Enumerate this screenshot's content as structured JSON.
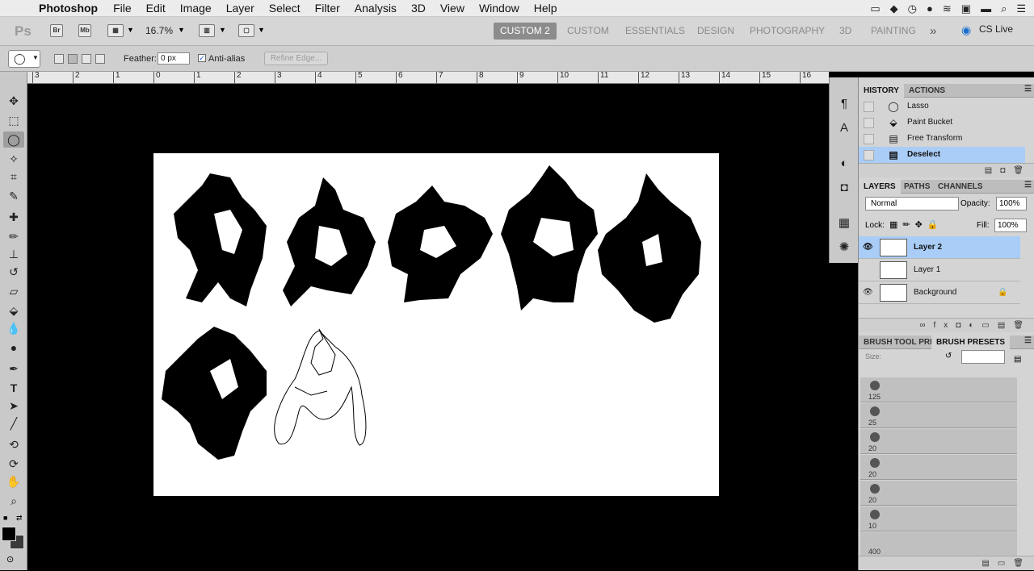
{
  "menubar": {
    "apple_icon": "apple-icon",
    "app_name": "Photoshop",
    "items": [
      "File",
      "Edit",
      "Image",
      "Layer",
      "Select",
      "Filter",
      "Analysis",
      "3D",
      "View",
      "Window",
      "Help"
    ]
  },
  "appbar": {
    "logo": "Ps",
    "bridge": "Br",
    "minibridge": "Mb",
    "zoom": "16.7%",
    "workspaces": [
      "CUSTOM 2",
      "CUSTOM",
      "ESSENTIALS",
      "DESIGN",
      "PHOTOGRAPHY",
      "3D",
      "PAINTING"
    ],
    "active_workspace": "CUSTOM 2",
    "more": "»",
    "cs_live": "CS Live"
  },
  "options": {
    "feather_label": "Feather:",
    "feather_value": "0 px",
    "antialias_label": "Anti-alias",
    "antialias_checked": true,
    "refine_edge": "Refine Edge..."
  },
  "ruler": {
    "labels": [
      "3",
      "2",
      "1",
      "0",
      "1",
      "2",
      "3",
      "4",
      "5",
      "6",
      "7",
      "8",
      "9",
      "10",
      "11",
      "12",
      "13",
      "14",
      "15",
      "16"
    ]
  },
  "history": {
    "tabs": [
      "HISTORY",
      "ACTIONS"
    ],
    "items": [
      {
        "name": "Lasso",
        "icon": "lasso-icon",
        "selected": false
      },
      {
        "name": "Paint Bucket",
        "icon": "paint-bucket-icon",
        "selected": false
      },
      {
        "name": "Free Transform",
        "icon": "document-icon",
        "selected": false
      },
      {
        "name": "Deselect",
        "icon": "document-icon",
        "selected": true
      }
    ]
  },
  "layers": {
    "tabs": [
      "LAYERS",
      "PATHS",
      "CHANNELS"
    ],
    "blend_mode": "Normal",
    "opacity_label": "Opacity:",
    "opacity": "100%",
    "lock_label": "Lock:",
    "fill_label": "Fill:",
    "fill": "100%",
    "items": [
      {
        "name": "Layer 2",
        "visible": true,
        "selected": true
      },
      {
        "name": "Layer 1",
        "visible": false,
        "selected": false
      },
      {
        "name": "Background",
        "visible": true,
        "selected": false,
        "locked": true
      }
    ]
  },
  "brushes": {
    "tabs": [
      "BRUSH",
      "TOOL PRE",
      "BRUSH PRESETS"
    ],
    "size_label": "Size:",
    "presets": [
      "125",
      "25",
      "20",
      "20",
      "20",
      "10",
      "400"
    ]
  },
  "colors": {
    "accent": "#a9cdf7",
    "panel_bg": "#d4d4d4",
    "canvas_bg": "#000000",
    "foreground": "#000000",
    "background": "#3a3a3a"
  }
}
